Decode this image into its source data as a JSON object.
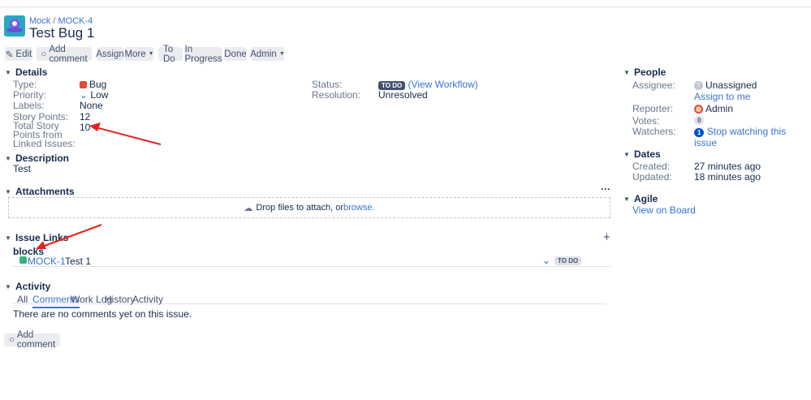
{
  "breadcrumb": {
    "project": "Mock",
    "issue_key": "MOCK-4"
  },
  "title": "Test Bug 1",
  "toolbar": {
    "edit": "Edit",
    "add_comment": "Add comment",
    "assign": "Assign",
    "more": "More",
    "todo": "To Do",
    "in_progress": "In Progress",
    "done": "Done",
    "admin": "Admin"
  },
  "details": {
    "heading": "Details",
    "type_label": "Type:",
    "type": "Bug",
    "priority_label": "Priority:",
    "priority": "Low",
    "labels_label": "Labels:",
    "labels": "None",
    "sp_label": "Story Points:",
    "sp": "12",
    "total_label": "Total Story Points from Linked Issues:",
    "total": "10",
    "status_label": "Status:",
    "status": "TO DO",
    "view_workflow": "(View Workflow)",
    "resolution_label": "Resolution:",
    "resolution": "Unresolved"
  },
  "description": {
    "heading": "Description",
    "text": "Test"
  },
  "attachments": {
    "heading": "Attachments",
    "more": "···",
    "drop": "Drop files to attach, or ",
    "browse": "browse."
  },
  "links": {
    "heading": "Issue Links",
    "add": "+",
    "type": "blocks",
    "key": "MOCK-1",
    "summary": "Test 1",
    "status": "TO DO"
  },
  "activity": {
    "heading": "Activity",
    "tabs": [
      "All",
      "Comments",
      "Work Log",
      "History",
      "Activity"
    ],
    "empty": "There are no comments yet on this issue.",
    "add_comment": "Add comment"
  },
  "people": {
    "heading": "People",
    "assignee_label": "Assignee:",
    "assignee": "Unassigned",
    "assign_me": "Assign to me",
    "reporter_label": "Reporter:",
    "reporter": "Admin",
    "votes_label": "Votes:",
    "votes": "0",
    "watchers_label": "Watchers:",
    "watchers": "1",
    "stop_watching": "Stop watching this issue"
  },
  "dates": {
    "heading": "Dates",
    "created_label": "Created:",
    "created": "27 minutes ago",
    "updated_label": "Updated:",
    "updated": "18 minutes ago"
  },
  "agile": {
    "heading": "Agile",
    "view_board": "View on Board"
  },
  "colors": {
    "accent": "#3b73d1",
    "arrow": "#e3231b"
  }
}
